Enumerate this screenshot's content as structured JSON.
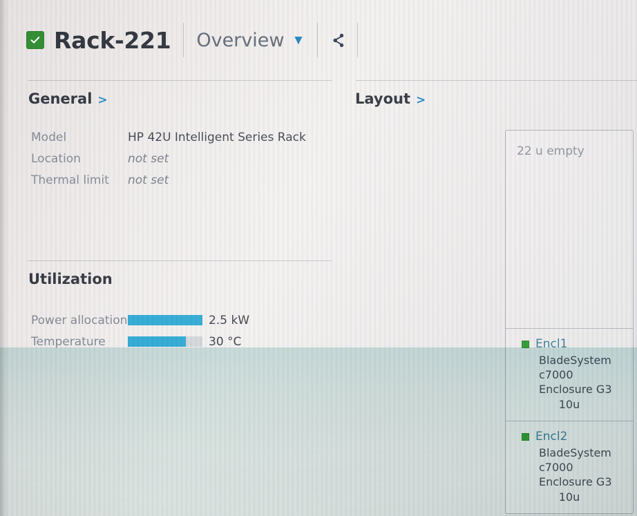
{
  "header": {
    "status_icon": "check-badge-icon",
    "status_color": "#2e8b2e",
    "title": "Rack-221",
    "view_selector": {
      "label": "Overview",
      "caret_icon": "chevron-down-icon",
      "caret_color": "#1b7fbf"
    },
    "branch_icon": "share-branch-icon"
  },
  "left_column": {
    "general": {
      "heading": "General",
      "heading_arrow": ">",
      "properties": [
        {
          "key": "Model",
          "value": "HP 42U Intelligent Series Rack",
          "unset": false
        },
        {
          "key": "Location",
          "value": "not set",
          "unset": true
        },
        {
          "key": "Thermal limit",
          "value": "not set",
          "unset": true
        }
      ]
    },
    "utilization": {
      "heading": "Utilization",
      "metrics": [
        {
          "key": "Power allocation",
          "value": "2.5 kW",
          "percent": 100
        },
        {
          "key": "Temperature",
          "value": "30 °C",
          "percent": 78
        }
      ],
      "bar_fill_color": "#2aa8d4",
      "bar_track_color": "#d2d6da"
    }
  },
  "right_column": {
    "layout": {
      "heading": "Layout",
      "heading_arrow": ">",
      "rack_slots": [
        {
          "type": "empty",
          "label": "22 u empty"
        },
        {
          "type": "enclosure",
          "status_icon": "status-square-icon",
          "status_color": "#2f9c34",
          "name": "Encl1",
          "description": "BladeSystem c7000 Enclosure G3",
          "size": "10u"
        },
        {
          "type": "enclosure",
          "status_icon": "status-square-icon",
          "status_color": "#2f9c34",
          "name": "Encl2",
          "description": "BladeSystem c7000 Enclosure G3",
          "size": "10u"
        }
      ]
    }
  }
}
